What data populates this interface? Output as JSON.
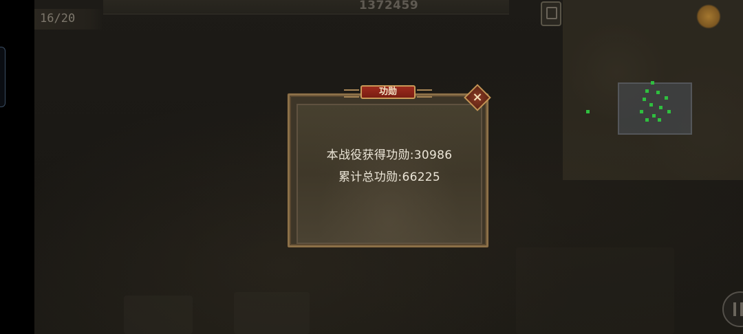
{
  "hud": {
    "score": "1372459",
    "counter": "16/20"
  },
  "dialog": {
    "title": "功勋",
    "close_icon": "×",
    "battle_merit_line": "本战役获得功勋:30986",
    "total_merit_line": "累计总功勋:66225"
  },
  "colors": {
    "dialog_text": "#ece6d8",
    "title_ribbon": "#9b2b1d",
    "frame_gold": "#8c7048",
    "minimap_units": "#2fbf3f"
  }
}
